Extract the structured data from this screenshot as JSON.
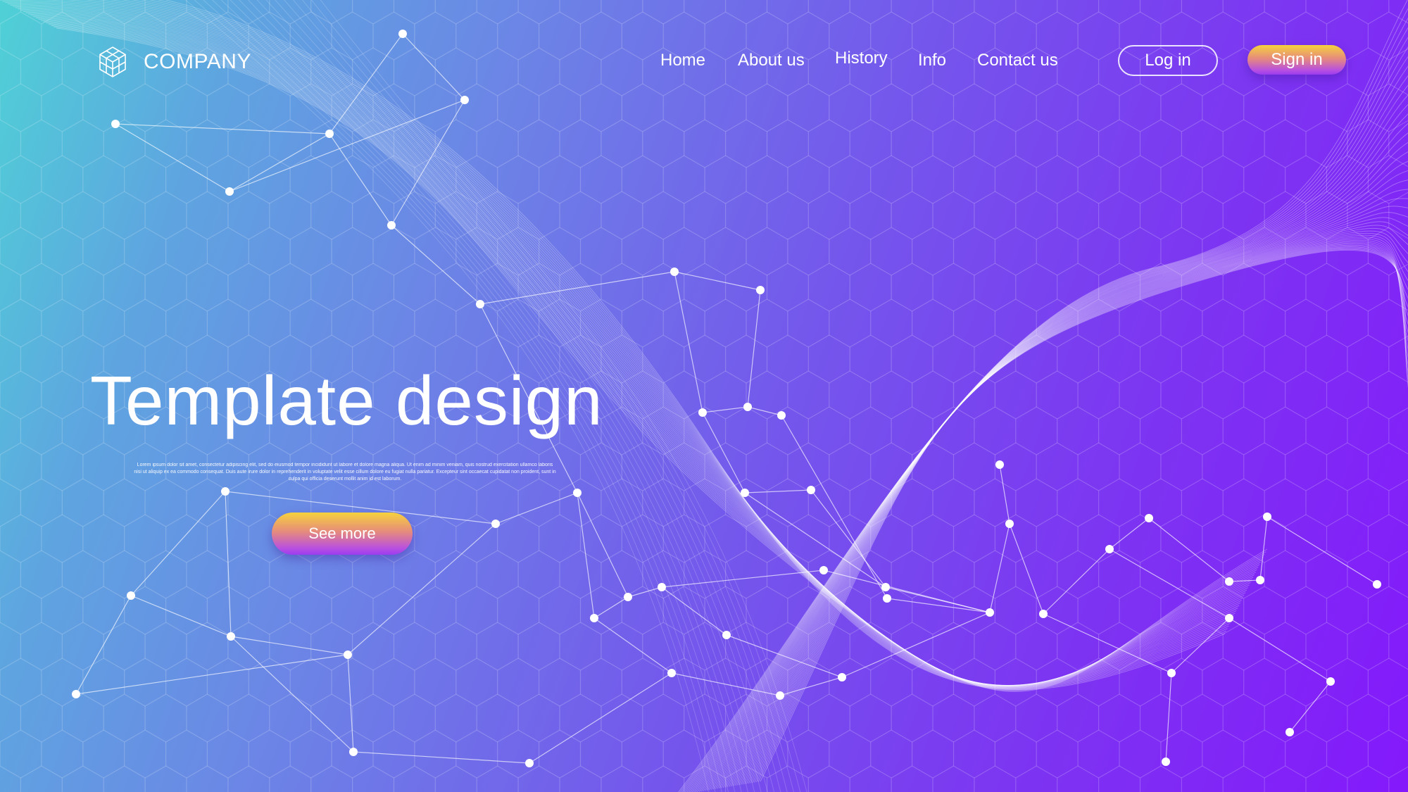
{
  "brand": {
    "name": "COMPANY",
    "logo_icon": "hexagon-cube-logo-icon"
  },
  "nav": {
    "items": [
      {
        "label": "Home"
      },
      {
        "label": "About us"
      },
      {
        "label": "History"
      },
      {
        "label": "Info"
      },
      {
        "label": "Contact us"
      }
    ]
  },
  "auth": {
    "login_label": "Log in",
    "signin_label": "Sign in"
  },
  "hero": {
    "title": "Template design",
    "body": "Lorem ipsum dolor sit amet, consectetur adipiscing elit, sed do eiusmod tempor incididunt ut labore et dolore magna aliqua. Ut enim ad minim veniam, quis nostrud exercitation ullamco laboris nisi ut aliquip ex ea commodo consequat. Duis aute irure dolor in reprehenderit in voluptate velit esse cillum dolore eu fugiat nulla pariatur. Excepteur sint occaecat cupidatat non proident, sunt in culpa qui officia deserunt mollit anim id est laborum.",
    "cta_label": "See more"
  },
  "colors": {
    "gradient_start": "#4fd1d6",
    "gradient_mid": "#7457ec",
    "gradient_end": "#8419fb",
    "button_gradient_top": "#f6d23c",
    "button_gradient_bottom": "#9b3cf0"
  }
}
